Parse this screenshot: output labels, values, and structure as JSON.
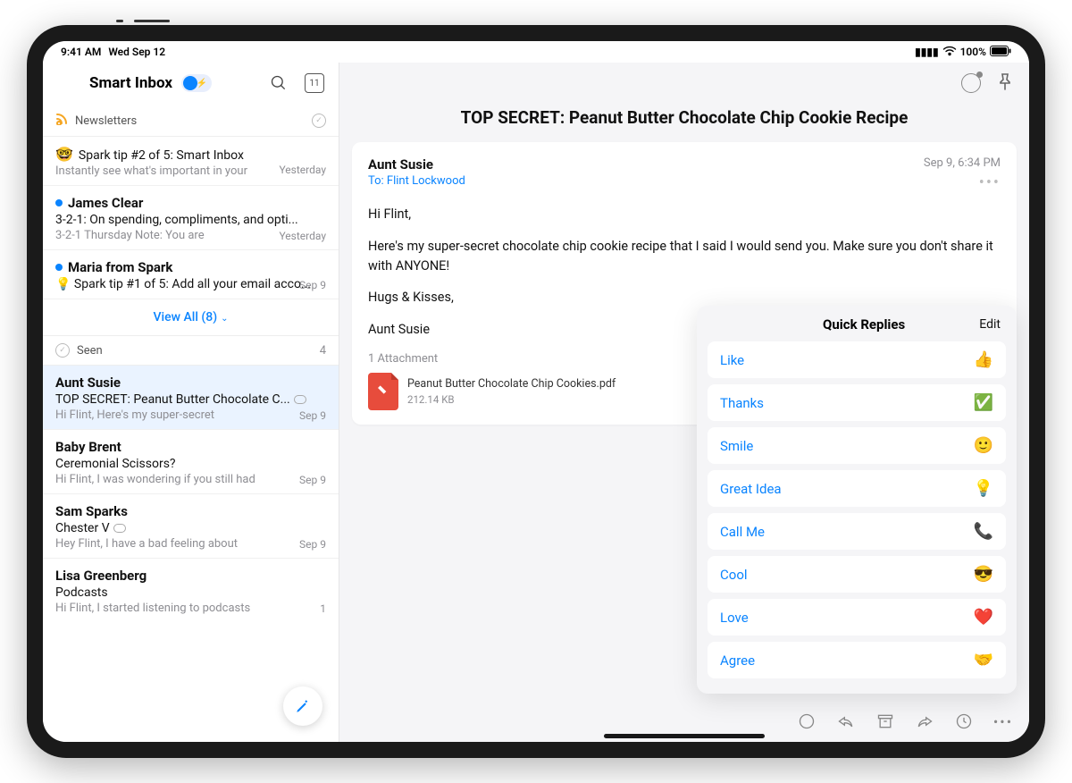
{
  "status": {
    "time": "9:41 AM",
    "date": "Wed Sep 12",
    "battery": "100%"
  },
  "sidebar": {
    "title": "Smart Inbox",
    "calendar_day": "11",
    "sections": {
      "newsletters": {
        "label": "Newsletters"
      },
      "seen": {
        "label": "Seen",
        "count": "4"
      }
    },
    "view_all": "View All (8)",
    "messages_new": [
      {
        "emoji": "🤓",
        "sender": "",
        "subject": "Spark tip #2 of 5: Smart Inbox",
        "preview": "Instantly see what's important in your",
        "date": "Yesterday",
        "unread": false
      },
      {
        "sender": "James Clear",
        "subject": "3-2-1: On spending, compliments, and opti...",
        "preview": "3-2-1 Thursday Note: You are",
        "date": "Yesterday",
        "unread": true
      },
      {
        "sender": "Maria from Spark",
        "subject": "💡 Spark tip #1 of 5: Add all your email acco...",
        "preview": "",
        "date": "Sep 9",
        "unread": true
      }
    ],
    "messages_seen": [
      {
        "sender": "Aunt Susie",
        "subject": "TOP SECRET: Peanut Butter Chocolate C...",
        "preview": "Hi Flint, Here's my super-secret",
        "date": "Sep 9",
        "has_attachment": true,
        "selected": true
      },
      {
        "sender": "Baby Brent",
        "subject": "Ceremonial Scissors?",
        "preview": "Hi Flint, I was wondering if you still had",
        "date": "Sep 9"
      },
      {
        "sender": "Sam Sparks",
        "subject": "Chester V",
        "preview": "Hey Flint, I have a bad feeling about",
        "date": "Sep 9",
        "has_attachment": true
      },
      {
        "sender": "Lisa Greenberg",
        "subject": "Podcasts",
        "preview": "Hi Flint, I started listening to podcasts",
        "date": "1"
      }
    ]
  },
  "email": {
    "subject": "TOP SECRET: Peanut Butter Chocolate Chip Cookie Recipe",
    "from": "Aunt Susie",
    "to_label": "To: Flint Lockwood",
    "timestamp": "Sep 9, 6:34 PM",
    "greeting": "Hi Flint,",
    "para1": "Here's my super-secret chocolate chip cookie recipe that I said I would send you. Make sure you don't share it with ANYONE!",
    "signoff": "Hugs & Kisses,",
    "signature": "Aunt Susie",
    "attachment_label": "1 Attachment",
    "attachment": {
      "name": "Peanut Butter Chocolate Chip Cookies.pdf",
      "size": "212.14 KB"
    }
  },
  "quick_replies": {
    "title": "Quick Replies",
    "edit": "Edit",
    "items": [
      {
        "label": "Like",
        "emoji": "👍"
      },
      {
        "label": "Thanks",
        "emoji": "✅"
      },
      {
        "label": "Smile",
        "emoji": "🙂"
      },
      {
        "label": "Great Idea",
        "emoji": "💡"
      },
      {
        "label": "Call Me",
        "emoji": "📞"
      },
      {
        "label": "Cool",
        "emoji": "😎"
      },
      {
        "label": "Love",
        "emoji": "❤️"
      },
      {
        "label": "Agree",
        "emoji": "🤝"
      }
    ]
  }
}
